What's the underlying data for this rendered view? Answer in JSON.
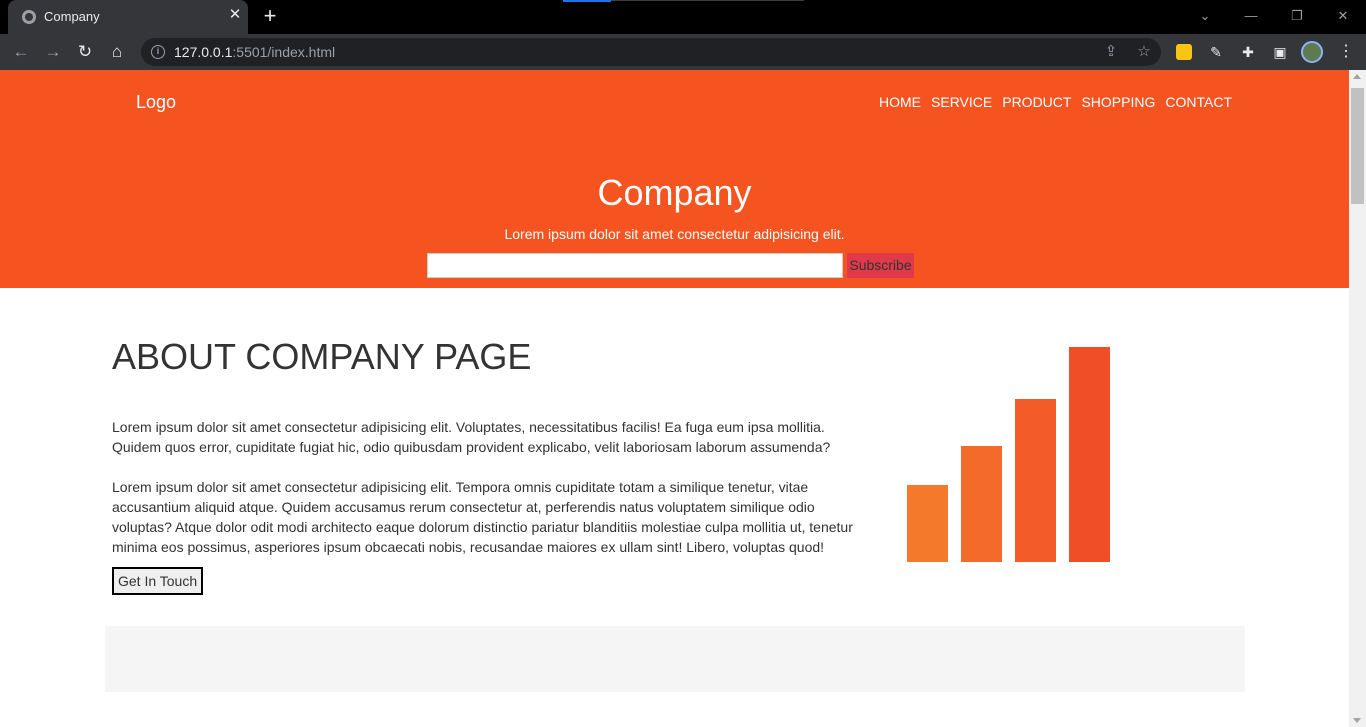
{
  "browser": {
    "tab_title": "Company",
    "url_host": "127.0.0.1",
    "url_rest": ":5501/index.html",
    "icons": [
      "back-icon",
      "forward-icon",
      "reload-icon",
      "home-icon",
      "info-icon",
      "share-icon",
      "star-icon",
      "extension-icon",
      "sidebar-icon",
      "menu-icon"
    ]
  },
  "site": {
    "logo": "Logo",
    "nav": [
      "HOME",
      "SERVICE",
      "PRODUCT",
      "SHOPPING",
      "CONTACT"
    ],
    "hero_title": "Company",
    "hero_subtitle": "Lorem ipsum dolor sit amet consectetur adipisicing elit.",
    "subscribe_value": "",
    "subscribe_label": "Subscribe",
    "accent_color": "#f55421",
    "button_color": "#e0394a"
  },
  "about": {
    "title": "ABOUT COMPANY PAGE",
    "paragraph1": "Lorem ipsum dolor sit amet consectetur adipisicing elit. Voluptates, necessitatibus facilis! Ea fuga eum ipsa mollitia. Quidem quos error, cupiditate fugiat hic, odio quibusdam provident explicabo, velit laboriosam laborum assumenda?",
    "paragraph2": "Lorem ipsum dolor sit amet consectetur adipisicing elit. Tempora omnis cupiditate totam a similique tenetur, vitae accusantium aliquid atque. Quidem accusamus rerum consectetur at, perferendis natus voluptatem similique odio voluptas? Atque dolor odit modi architecto eaque dolorum distinctio pariatur blanditiis molestiae culpa mollitia ut, tenetur minima eos possimus, asperiores ipsum obcaecati nobis, recusandae maiores ex ullam sint! Libero, voluptas quod!",
    "cta_label": "Get In Touch"
  },
  "illustration": {
    "type": "bar-graph-icon",
    "relative_heights": [
      0.36,
      0.54,
      0.76,
      1.0
    ],
    "colors": [
      "#f5792a",
      "#f46a2a",
      "#f35b29",
      "#f04e27"
    ]
  }
}
